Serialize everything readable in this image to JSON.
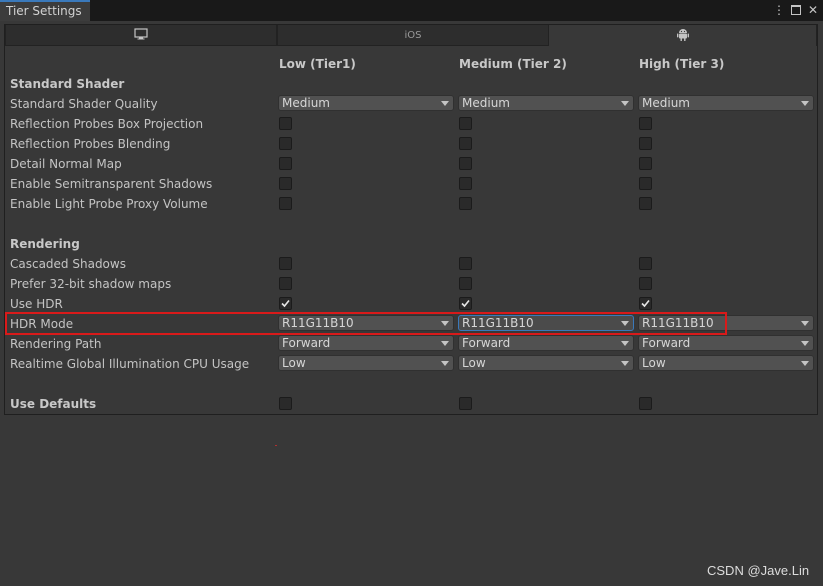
{
  "window": {
    "title": "Tier Settings",
    "menu_icon": "vertical-ellipsis-icon",
    "maximize_icon": "maximize-icon",
    "close_icon": "close-icon",
    "menu_glyph": "⋮",
    "close_glyph": "✕"
  },
  "platform_tabs": [
    {
      "icon": "monitor-icon",
      "label": "",
      "active": false
    },
    {
      "icon": "",
      "label": "iOS",
      "active": false
    },
    {
      "icon": "android-icon",
      "label": "",
      "active": true
    }
  ],
  "columns": [
    "Low (Tier1)",
    "Medium (Tier 2)",
    "High (Tier 3)"
  ],
  "sections": {
    "standard_shader": "Standard Shader",
    "rendering": "Rendering"
  },
  "rows": {
    "standard_shader_quality": {
      "label": "Standard Shader Quality",
      "values": [
        "Medium",
        "Medium",
        "Medium"
      ]
    },
    "reflection_probes_box_projection": {
      "label": "Reflection Probes Box Projection",
      "values": [
        false,
        false,
        false
      ]
    },
    "reflection_probes_blending": {
      "label": "Reflection Probes Blending",
      "values": [
        false,
        false,
        false
      ]
    },
    "detail_normal_map": {
      "label": "Detail Normal Map",
      "values": [
        false,
        false,
        false
      ]
    },
    "enable_semitransparent_shadows": {
      "label": "Enable Semitransparent Shadows",
      "values": [
        false,
        false,
        false
      ]
    },
    "enable_light_probe_proxy_volume": {
      "label": "Enable Light Probe Proxy Volume",
      "values": [
        false,
        false,
        false
      ]
    },
    "cascaded_shadows": {
      "label": "Cascaded Shadows",
      "values": [
        false,
        false,
        false
      ]
    },
    "prefer_32bit_shadow_maps": {
      "label": "Prefer 32-bit shadow maps",
      "values": [
        false,
        false,
        false
      ]
    },
    "use_hdr": {
      "label": "Use HDR",
      "values": [
        true,
        true,
        true
      ]
    },
    "hdr_mode": {
      "label": "HDR Mode",
      "values": [
        "R11G11B10",
        "R11G11B10",
        "R11G11B10"
      ]
    },
    "rendering_path": {
      "label": "Rendering Path",
      "values": [
        "Forward",
        "Forward",
        "Forward"
      ]
    },
    "realtime_gi_cpu_usage": {
      "label": "Realtime Global Illumination CPU Usage",
      "values": [
        "Low",
        "Low",
        "Low"
      ]
    },
    "use_defaults": {
      "label": "Use Defaults",
      "values": [
        false,
        false,
        false
      ]
    }
  },
  "colors": {
    "background": "#383838",
    "highlight": "#d91a1a",
    "focus": "#3a79bb"
  },
  "watermark": "CSDN @Jave.Lin"
}
